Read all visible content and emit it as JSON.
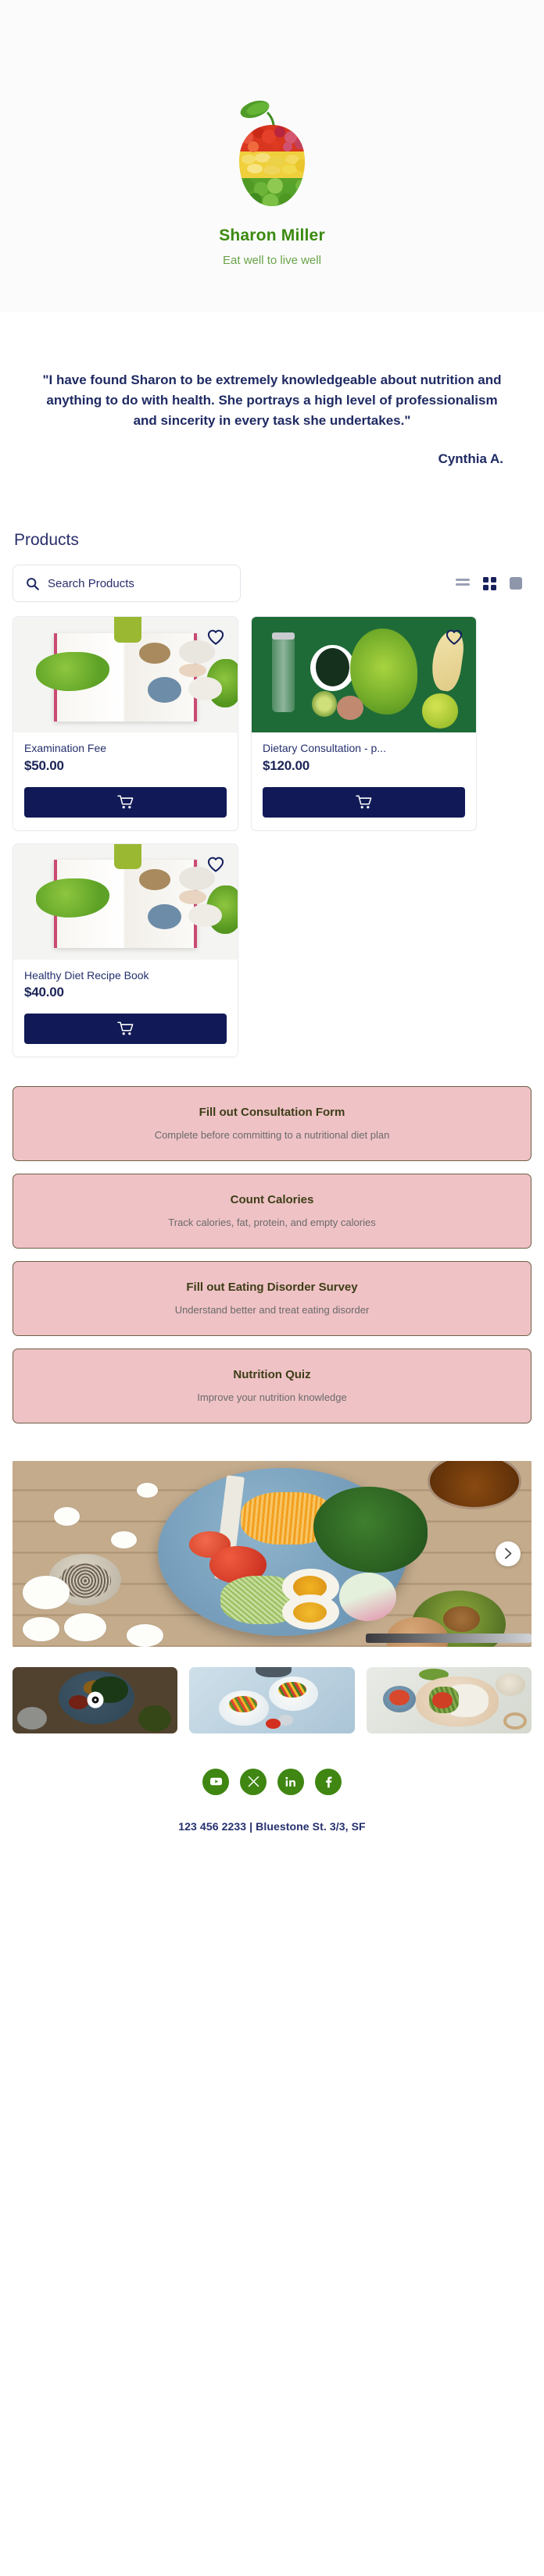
{
  "header": {
    "logo_icon": "fruit-apple-logo",
    "brand_name": "Sharon Miller",
    "tagline": "Eat well to live well",
    "brand_color": "#3b8a10",
    "tagline_color": "#6aa348"
  },
  "testimonial": {
    "quote": "\"I have found Sharon to be extremely knowledgeable about nutrition and anything to do with health.  She portrays a high level of professionalism and sincerity in every task she undertakes.\"",
    "author": "Cynthia A.",
    "text_color": "#1f2a63"
  },
  "products": {
    "section_title": "Products",
    "search": {
      "placeholder": "Search Products",
      "value": "",
      "icon": "search-icon"
    },
    "view_toggles": [
      {
        "name": "list-view-icon",
        "label": "List view",
        "selected": false
      },
      {
        "name": "grid-view-icon",
        "label": "Grid view",
        "selected": true
      },
      {
        "name": "large-view-icon",
        "label": "Large view",
        "selected": false
      }
    ],
    "items": [
      {
        "name": "Examination Fee",
        "price": "$50.00",
        "image": "open-recipe-book-with-kale",
        "favorite_icon": "heart-icon",
        "cart_icon": "shopping-cart-icon"
      },
      {
        "name": "Dietary Consultation - p...",
        "price": "$120.00",
        "image": "green-flatlay-water-bottle-vegetables",
        "favorite_icon": "heart-icon",
        "cart_icon": "shopping-cart-icon"
      },
      {
        "name": "Healthy Diet Recipe Book",
        "price": "$40.00",
        "image": "open-recipe-book-with-kale",
        "favorite_icon": "heart-icon",
        "cart_icon": "shopping-cart-icon"
      }
    ],
    "accent_navy": "#111a56"
  },
  "actions": {
    "card_bg": "#efc2c6",
    "title_color": "#3d3e16",
    "items": [
      {
        "title": "Fill out Consultation Form",
        "subtitle": "Complete before committing to a nutritional diet plan"
      },
      {
        "title": "Count Calories",
        "subtitle": "Track calories, fat, protein, and empty calories"
      },
      {
        "title": "Fill out Eating Disorder Survey",
        "subtitle": "Understand better and treat eating disorder"
      },
      {
        "title": "Nutrition Quiz",
        "subtitle": "Improve your nutrition knowledge"
      }
    ]
  },
  "gallery": {
    "hero_image": "salad-bowl-on-rustic-wood-flatlay",
    "next_icon": "chevron-right-icon",
    "thumbnails": [
      {
        "image": "salad-bowl-on-rustic-wood-flatlay",
        "active": true
      },
      {
        "image": "yogurt-bowls-with-fruit-on-blue",
        "active": false
      },
      {
        "image": "grain-bowl-with-vegetables",
        "active": false
      }
    ]
  },
  "footer": {
    "social": [
      {
        "name": "youtube-icon",
        "label": "YouTube"
      },
      {
        "name": "x-twitter-icon",
        "label": "X"
      },
      {
        "name": "linkedin-icon",
        "label": "LinkedIn"
      },
      {
        "name": "facebook-icon",
        "label": "Facebook"
      }
    ],
    "social_color": "#3f8612",
    "contact": "123 456 2233 | Bluestone St. 3/3, SF"
  }
}
